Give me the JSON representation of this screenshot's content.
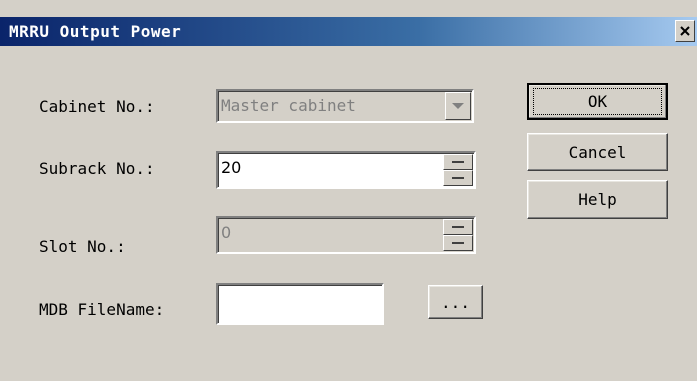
{
  "window": {
    "title": "MRRU Output Power",
    "close_glyph": "✕"
  },
  "form": {
    "cabinet": {
      "label": "Cabinet No.:",
      "value": "Master cabinet",
      "disabled": true
    },
    "subrack": {
      "label": "Subrack No.:",
      "value": "20"
    },
    "slot": {
      "label": "Slot No.:",
      "value": "0",
      "disabled": true
    },
    "mdb": {
      "label": "MDB FileName:",
      "value": "",
      "browse_label": "..."
    }
  },
  "buttons": {
    "ok": "OK",
    "cancel": "Cancel",
    "help": "Help"
  },
  "colors": {
    "dialog_bg": "#d4d0c8",
    "title_start": "#0a246a",
    "title_end": "#a6caf0"
  }
}
